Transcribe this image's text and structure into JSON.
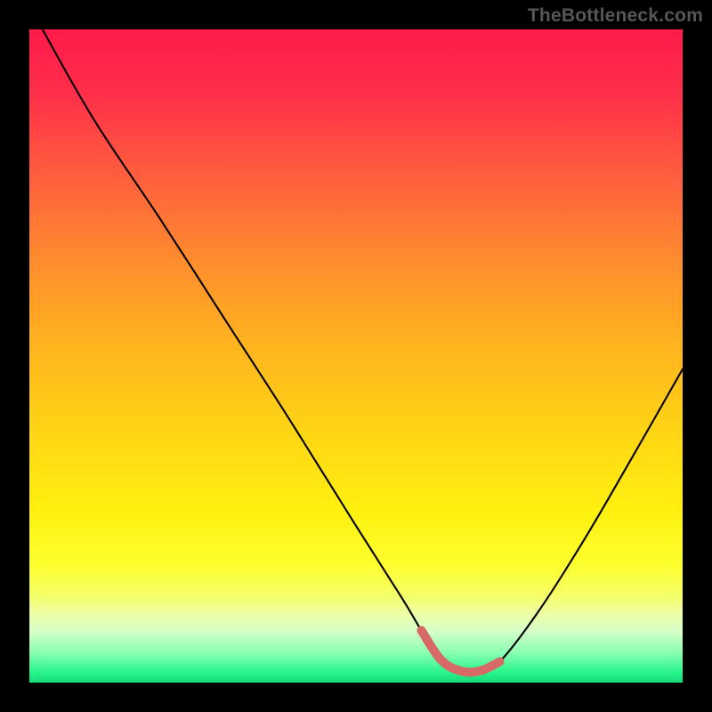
{
  "attribution": "TheBottleneck.com",
  "gradient_stops": [
    {
      "offset": 0.0,
      "color": "#ff1a4a"
    },
    {
      "offset": 0.1,
      "color": "#ff2f49"
    },
    {
      "offset": 0.22,
      "color": "#ff5d3e"
    },
    {
      "offset": 0.35,
      "color": "#ff8b2f"
    },
    {
      "offset": 0.48,
      "color": "#ffb31f"
    },
    {
      "offset": 0.62,
      "color": "#ffd614"
    },
    {
      "offset": 0.74,
      "color": "#fff110"
    },
    {
      "offset": 0.82,
      "color": "#fdff2e"
    },
    {
      "offset": 0.865,
      "color": "#f6ff66"
    },
    {
      "offset": 0.895,
      "color": "#ecffa5"
    },
    {
      "offset": 0.92,
      "color": "#d8ffc8"
    },
    {
      "offset": 0.955,
      "color": "#87ffb2"
    },
    {
      "offset": 0.985,
      "color": "#27f58b"
    },
    {
      "offset": 1.0,
      "color": "#17d879"
    }
  ],
  "curve_color": "#000000",
  "chart_data": {
    "type": "line",
    "title": "",
    "xlabel": "",
    "ylabel": "",
    "xlim": [
      0,
      100
    ],
    "ylim": [
      0,
      100
    ],
    "series": [
      {
        "name": "bottleneck-curve",
        "x_pct": [
          2,
          10,
          20,
          30,
          40,
          50,
          57,
          60,
          63,
          66,
          69,
          72,
          78,
          85,
          92,
          100
        ],
        "y_pct": [
          100,
          86,
          71,
          55.5,
          40,
          24,
          13,
          8,
          3.5,
          1.8,
          1.8,
          3.2,
          11,
          22,
          34,
          48
        ]
      }
    ],
    "marker": {
      "name": "optimal-range",
      "color": "#d86a66",
      "x_pct": [
        60,
        63,
        66,
        69,
        72
      ],
      "y_pct": [
        8,
        3.5,
        1.8,
        1.8,
        3.2
      ]
    }
  }
}
